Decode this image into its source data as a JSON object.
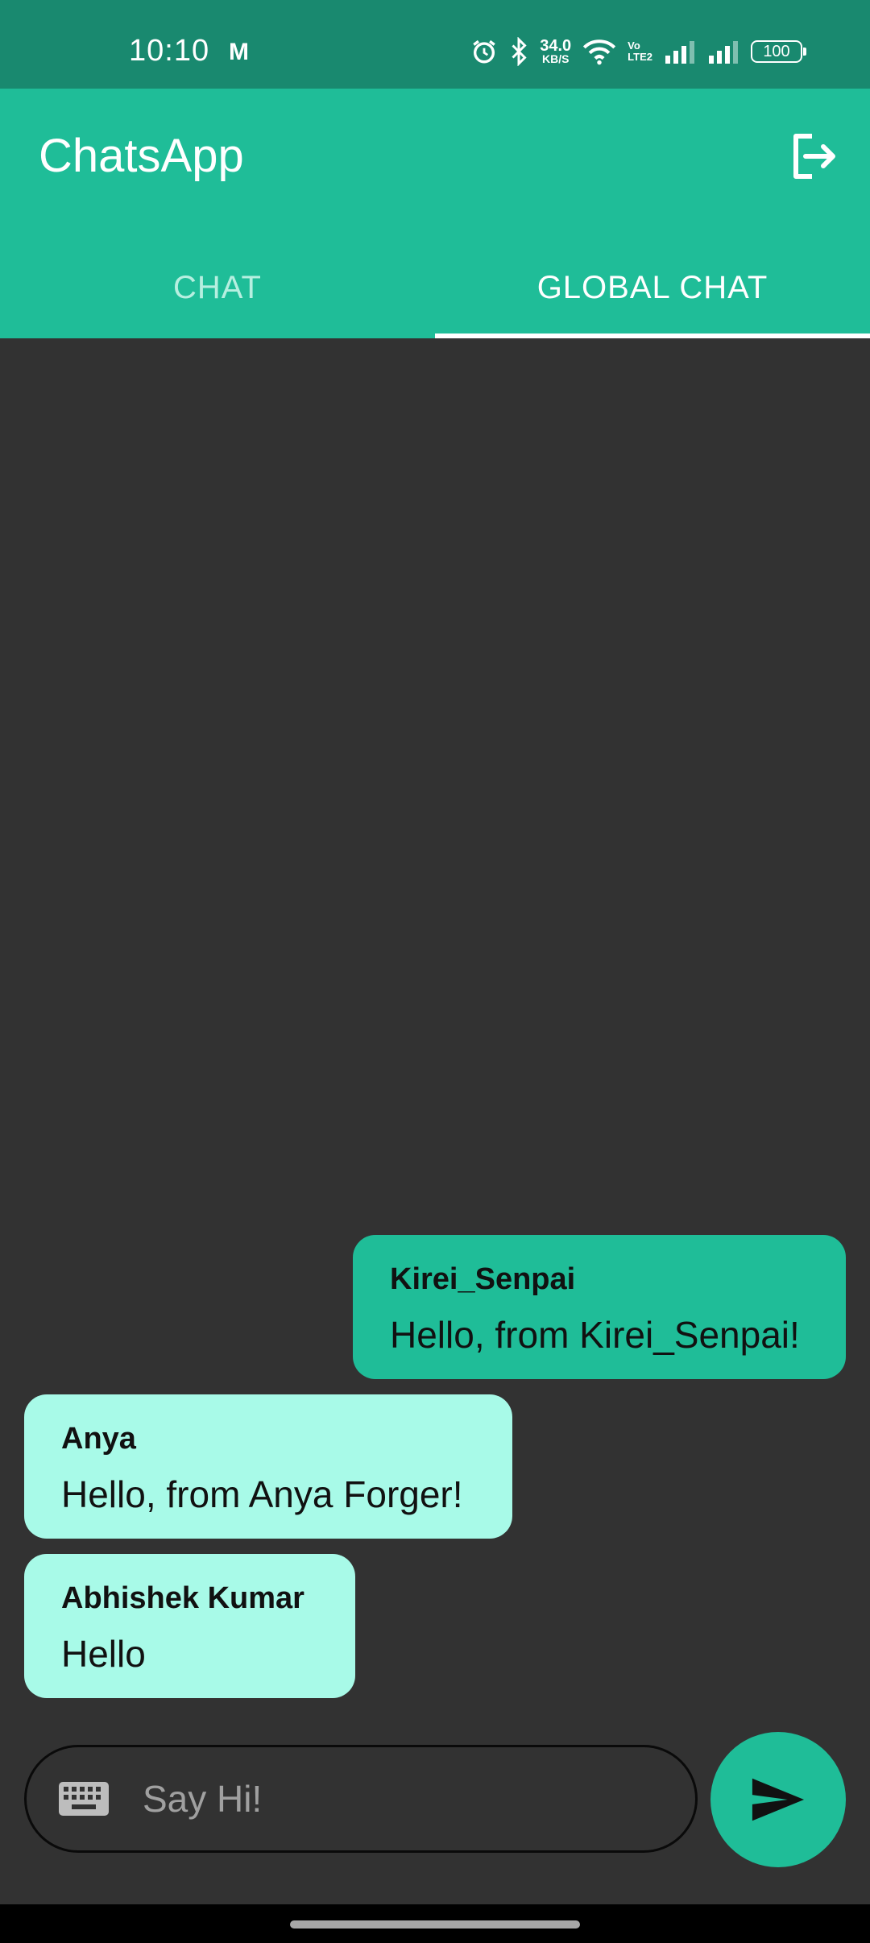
{
  "status_bar": {
    "time": "10:10",
    "carrier_glyph": "M",
    "net_speed": "34.0",
    "net_speed_unit": "KB/S",
    "volte_top": "Vo",
    "volte_bottom": "LTE2",
    "battery": "100",
    "icons": [
      "alarm-icon",
      "bluetooth-icon",
      "wifi-icon",
      "signal-icon",
      "signal-icon"
    ]
  },
  "app_bar": {
    "title": "ChatsApp",
    "logout_icon": "logout-icon"
  },
  "tabs": [
    {
      "label": "CHAT",
      "active": false
    },
    {
      "label": "GLOBAL CHAT",
      "active": true
    }
  ],
  "messages": [
    {
      "sender": "Kirei_Senpai",
      "text": "Hello, from Kirei_Senpai!",
      "own": true
    },
    {
      "sender": "Anya",
      "text": "Hello, from Anya Forger!",
      "own": false
    },
    {
      "sender": "Abhishek Kumar",
      "text": "Hello",
      "own": false
    }
  ],
  "composer": {
    "placeholder": "Say Hi!",
    "keyboard_icon": "keyboard-icon",
    "send_icon": "send-icon"
  },
  "colors": {
    "status_bar": "#19896f",
    "primary": "#1fbd98",
    "background": "#323232",
    "incoming_bubble": "#a8fae8"
  }
}
